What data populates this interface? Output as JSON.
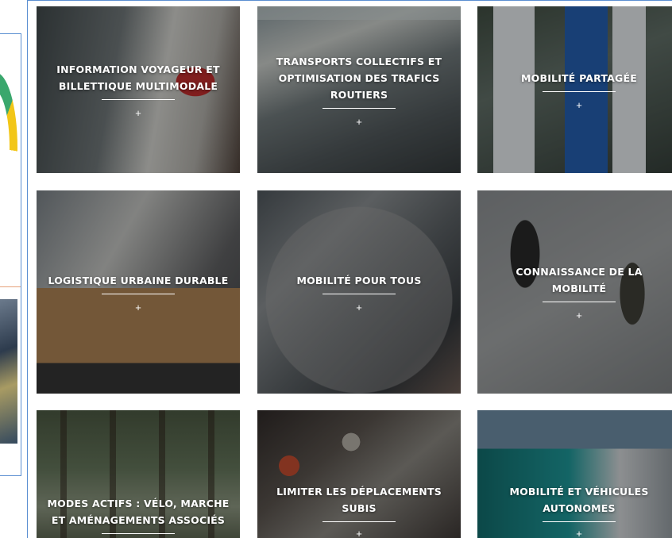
{
  "tiles": [
    {
      "title": "INFORMATION VOYAGEUR ET BILLETTIQUE MULTIMODALE",
      "plus": "+"
    },
    {
      "title": "TRANSPORTS COLLECTIFS ET OPTIMISATION DES TRAFICS ROUTIERS",
      "plus": "+"
    },
    {
      "title": "MOBILITÉ PARTAGÉE",
      "plus": "+"
    },
    {
      "title": "LOGISTIQUE URBAINE DURABLE",
      "plus": "+"
    },
    {
      "title": "MOBILITÉ POUR TOUS",
      "plus": "+"
    },
    {
      "title": "CONNAISSANCE DE LA MOBILITÉ",
      "plus": "+"
    },
    {
      "title": "MODES ACTIFS : VÉLO, MARCHE ET AMÉNAGEMENTS ASSOCIÉS",
      "plus": "+"
    },
    {
      "title": "LIMITER LES DÉPLACEMENTS SUBIS",
      "plus": "+"
    },
    {
      "title": "MOBILITÉ ET VÉHICULES AUTONOMES",
      "plus": "+"
    }
  ],
  "colors": {
    "frame_border": "#5b8fd1",
    "overlay_text": "#ffffff"
  }
}
